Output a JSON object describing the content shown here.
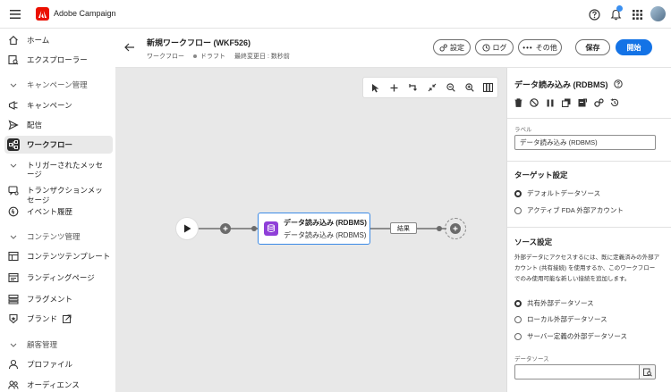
{
  "app": {
    "name": "Adobe Campaign"
  },
  "sidebar": {
    "home": "ホーム",
    "explorer": "エクスプローラー",
    "campaign_section": "キャンペーン管理",
    "campaigns": "キャンペーン",
    "deliveries": "配信",
    "workflows": "ワークフロー",
    "triggered_line1": "トリガーされたメッセ",
    "triggered_line2": "ージ",
    "transactional_line1": "トランザクションメッ",
    "transactional_line2": "セージ",
    "event_history": "イベント履歴",
    "content_section": "コンテンツ管理",
    "content_templates": "コンテンツテンプレート",
    "landing_pages": "ランディングページ",
    "fragments": "フラグメント",
    "brands": "ブランド",
    "customer_section": "顧客管理",
    "profiles": "プロファイル",
    "audiences": "オーディエンス"
  },
  "header": {
    "title": "新規ワークフロー (WKF526)",
    "type": "ワークフロー",
    "status": "ドラフト",
    "modified": "最終変更日 : 数秒前",
    "settings": "設定",
    "log": "ログ",
    "more": "その他",
    "save": "保存",
    "start": "開始"
  },
  "canvas": {
    "node_title": "データ読み込み (RDBMS)",
    "node_subtitle": "データ読み込み (RDBMS)",
    "result_label": "結果"
  },
  "panel": {
    "title": "データ読み込み (RDBMS)",
    "label_caption": "ラベル",
    "label_value": "データ読み込み (RDBMS)",
    "target_title": "ターゲット設定",
    "target_opt1": "デフォルトデータソース",
    "target_opt2": "アクティブ FDA 外部アカウント",
    "source_title": "ソース設定",
    "source_desc": "外部データにアクセスするには、既に定義済みの外部アカウント (共有接続) を使用するか、このワークフローでのみ使用可能な新しい接続を追加します。",
    "source_opt1": "共有外部データソース",
    "source_opt2": "ローカル外部データソース",
    "source_opt3": "サーバー定義の外部データソース",
    "datasource_caption": "データソース",
    "datasource_value": ""
  },
  "colors": {
    "accent": "#1473e6",
    "brand_red": "#eb1000",
    "node_icon": "#8f3fd8"
  }
}
